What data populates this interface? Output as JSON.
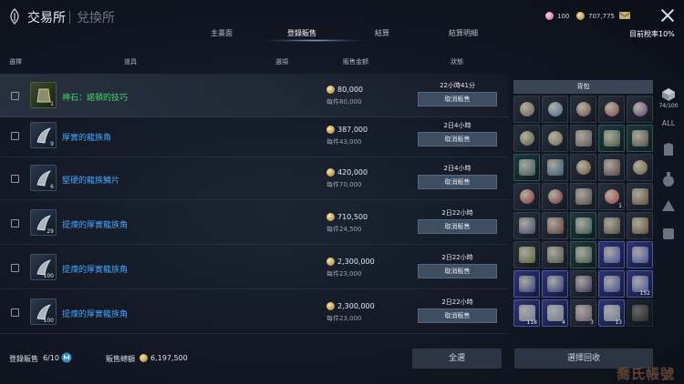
{
  "header": {
    "title": "交易所",
    "subtitle": "兌換所",
    "currency_gem": "100",
    "currency_coin": "707,775",
    "tax_label": "目前稅率10%"
  },
  "tabs": [
    {
      "label": "主畫面",
      "active": false
    },
    {
      "label": "登錄販售",
      "active": true
    },
    {
      "label": "結算",
      "active": false
    },
    {
      "label": "結算明細",
      "active": false
    }
  ],
  "columns": {
    "select": "選擇",
    "item": "道具",
    "option": "選項",
    "price": "販售金額",
    "status": "狀態"
  },
  "rows": [
    {
      "name": "神石：諾頓的技巧",
      "qty": "1",
      "price": "80,000",
      "unit": "每件80,000",
      "time": "22小時41分",
      "cancel": "取消販售",
      "color": "green"
    },
    {
      "name": "厚實的龍族角",
      "qty": "9",
      "price": "387,000",
      "unit": "每件43,000",
      "time": "2日4小時",
      "cancel": "取消販售",
      "color": "blue"
    },
    {
      "name": "堅硬的龍族鱗片",
      "qty": "6",
      "price": "420,000",
      "unit": "每件70,000",
      "time": "2日4小時",
      "cancel": "取消販售",
      "color": "blue"
    },
    {
      "name": "提煉的厚實龍族角",
      "qty": "29",
      "price": "710,500",
      "unit": "每件24,500",
      "time": "2日22小時",
      "cancel": "取消販售",
      "color": "blue"
    },
    {
      "name": "提煉的厚實龍族角",
      "qty": "100",
      "price": "2,300,000",
      "unit": "每件23,000",
      "time": "2日22小時",
      "cancel": "取消販售",
      "color": "blue"
    },
    {
      "name": "提煉的厚實龍族角",
      "qty": "100",
      "price": "2,300,000",
      "unit": "每件23,000",
      "time": "2日22小時",
      "cancel": "取消販售",
      "color": "blue"
    }
  ],
  "bag": {
    "title": "背包",
    "capacity": "74/100",
    "filter_all": "ALL",
    "slot_counts": [
      "",
      "",
      "",
      "",
      "",
      "",
      "",
      "",
      "",
      "",
      "",
      "",
      "",
      "",
      "",
      "",
      "",
      "",
      "1",
      "",
      "",
      "",
      "",
      "",
      "",
      "",
      "",
      "",
      "",
      "",
      "",
      "",
      "",
      "",
      "152",
      "118",
      "4",
      "3",
      "13",
      ""
    ]
  },
  "footer": {
    "listed_label": "登錄販售",
    "listed_count": "6/10",
    "total_label": "販售總額",
    "total_value": "6,197,500",
    "select_all": "全選",
    "reclaim": "選擇回收"
  },
  "watermark": "喬氏帳號"
}
